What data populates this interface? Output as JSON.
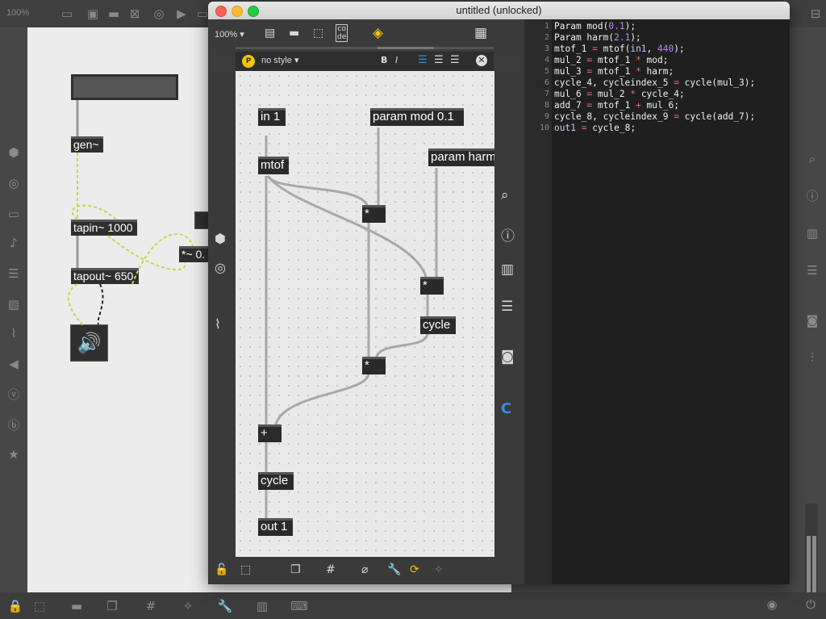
{
  "background_window": {
    "zoom_label": "100%",
    "objects": {
      "gen": "gen~",
      "tapin": "tapin~ 1000",
      "tapout": "tapout~ 650",
      "multiply": "*~ 0."
    }
  },
  "window": {
    "title": "untitled (unlocked)",
    "toolbar": {
      "zoom_label": "100%"
    },
    "stylebar": {
      "style_label": "no style",
      "bold_label": "B",
      "italic_label": "I"
    },
    "sidebar_icons": [
      "search-icon",
      "info-icon",
      "book-icon",
      "list-icon",
      "camera-icon",
      "c-icon"
    ],
    "patch_objects": {
      "in1": "in 1",
      "param_mod": "param mod 0.1",
      "param_harm": "param harm",
      "mtof": "mtof",
      "mul1": "*",
      "mul2": "*",
      "cycle1": "cycle",
      "mul3": "*",
      "add": "+",
      "cycle2": "cycle",
      "out1": "out 1"
    },
    "code_lines": [
      {
        "n": "1",
        "text": "Param mod(0.1);"
      },
      {
        "n": "2",
        "text": "Param harm(2.1);"
      },
      {
        "n": "3",
        "text": "mtof_1 = mtof(in1, 440);"
      },
      {
        "n": "4",
        "text": "mul_2 = mtof_1 * mod;"
      },
      {
        "n": "5",
        "text": "mul_3 = mtof_1 * harm;"
      },
      {
        "n": "6",
        "text": "cycle_4, cycleindex_5 = cycle(mul_3);"
      },
      {
        "n": "7",
        "text": "mul_6 = mul_2 * cycle_4;"
      },
      {
        "n": "8",
        "text": "add_7 = mtof_1 + mul_6;"
      },
      {
        "n": "9",
        "text": "cycle_8, cycleindex_9 = cycle(add_7);"
      },
      {
        "n": "10",
        "text": "out1 = cycle_8;"
      }
    ]
  },
  "colors": {
    "number": "#b48cf2",
    "keyword": "#c8c8ff",
    "accent": "#f1c40f",
    "link_blue": "#3b8fd8"
  }
}
